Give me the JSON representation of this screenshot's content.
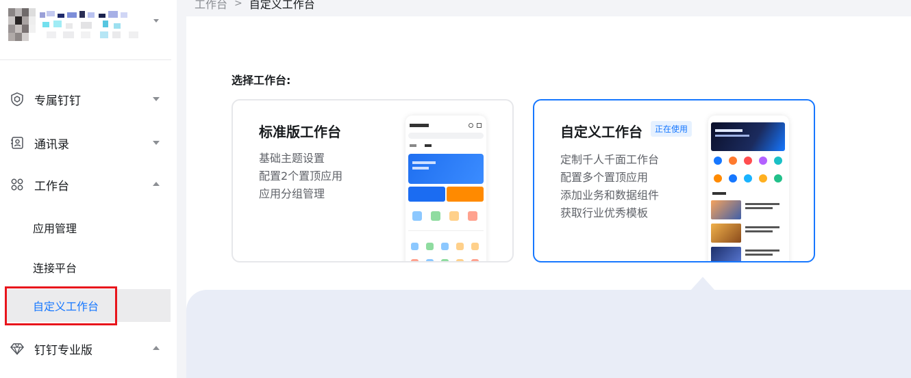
{
  "sidebar": {
    "org_name": "",
    "items": [
      {
        "label": "专属钉钉",
        "icon": "shield-icon",
        "state": "collapsed"
      },
      {
        "label": "通讯录",
        "icon": "contacts-icon",
        "state": "collapsed"
      },
      {
        "label": "工作台",
        "icon": "apps-grid-icon",
        "state": "expanded"
      },
      {
        "label": "钉钉专业版",
        "icon": "diamond-icon",
        "state": "expanded"
      }
    ],
    "sub_items": [
      {
        "label": "应用管理"
      },
      {
        "label": "连接平台"
      },
      {
        "label": "自定义工作台",
        "active": true
      }
    ]
  },
  "breadcrumb": {
    "root": "工作台",
    "separator": ">",
    "current": "自定义工作台"
  },
  "main": {
    "section_title": "选择工作台:",
    "cards": [
      {
        "title": "标准版工作台",
        "badge": "",
        "features": [
          "基础主题设置",
          "配置2个置顶应用",
          "应用分组管理"
        ],
        "selected": false
      },
      {
        "title": "自定义工作台",
        "badge": "正在使用",
        "features": [
          "定制千人千面工作台",
          "配置多个置顶应用",
          "添加业务和数据组件",
          "获取行业优秀模板"
        ],
        "selected": true
      }
    ]
  },
  "colors": {
    "accent": "#1677ff",
    "highlight": "#e8141b",
    "panel": "#e9edf7"
  }
}
